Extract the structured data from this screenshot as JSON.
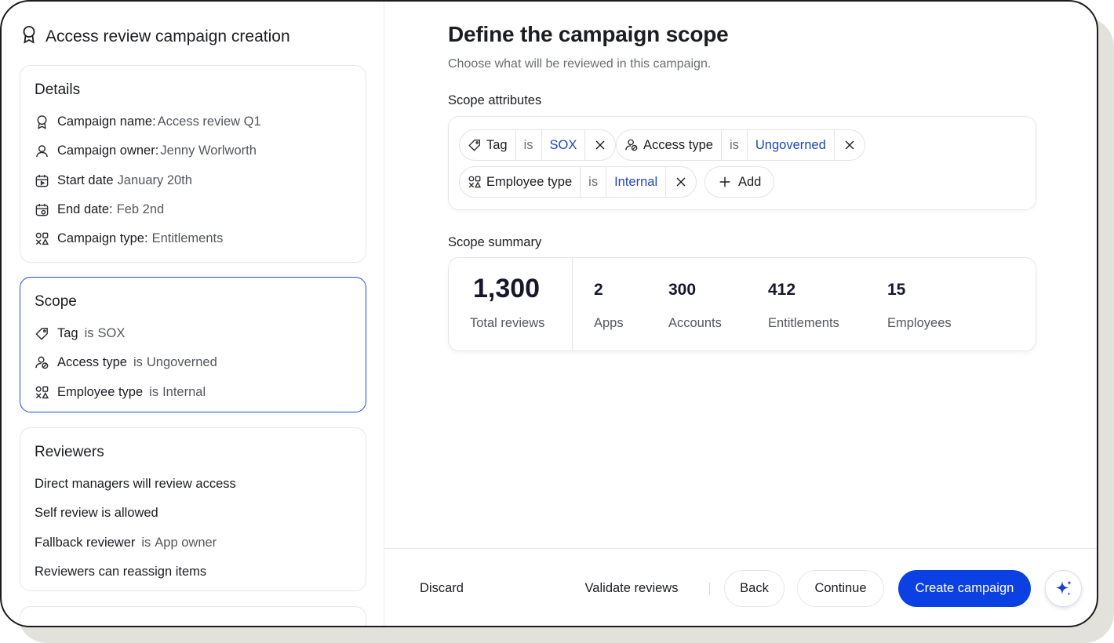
{
  "app": {
    "title": "Access review campaign creation"
  },
  "details": {
    "title": "Details",
    "rows": [
      {
        "label": "Campaign name:",
        "value": "Access review Q1",
        "icon": "badge-icon"
      },
      {
        "label": "Campaign owner:",
        "value": "Jenny Worlworth",
        "icon": "user-icon"
      },
      {
        "label": "Start date",
        "value": "January 20th",
        "icon": "calendar-start-icon"
      },
      {
        "label": "End date:",
        "value": "Feb 2nd",
        "icon": "calendar-end-icon"
      },
      {
        "label": "Campaign type:",
        "value": "Entitlements",
        "icon": "shapes-icon"
      }
    ]
  },
  "scope": {
    "title": "Scope",
    "rows": [
      {
        "label": "Tag",
        "op": "is",
        "value": "SOX",
        "icon": "tag-icon"
      },
      {
        "label": "Access type",
        "op": "is",
        "value": "Ungoverned",
        "icon": "access-type-icon"
      },
      {
        "label": "Employee type",
        "op": "is",
        "value": "Internal",
        "icon": "shapes-icon"
      }
    ]
  },
  "reviewers": {
    "title": "Reviewers",
    "rows": [
      {
        "text": "Direct managers will review access"
      },
      {
        "text": "Self review is allowed"
      },
      {
        "label": "Fallback reviewer",
        "op": "is",
        "value": "App owner"
      },
      {
        "text": "Reviewers can reassign items"
      }
    ]
  },
  "main": {
    "title": "Define the campaign scope",
    "subtitle": "Choose what will be reviewed in this campaign.",
    "attributes_label": "Scope attributes",
    "filters": [
      {
        "key": "Tag",
        "op": "is",
        "value": "SOX"
      },
      {
        "key": "Access type",
        "op": "is",
        "value": "Ungoverned"
      },
      {
        "key": "Employee type",
        "op": "is",
        "value": "Internal"
      }
    ],
    "add_label": "Add",
    "summary_label": "Scope summary",
    "summary": {
      "total": {
        "value": "1,300",
        "label": "Total reviews"
      },
      "stats": [
        {
          "value": "2",
          "label": "Apps"
        },
        {
          "value": "300",
          "label": "Accounts"
        },
        {
          "value": "412",
          "label": "Entitlements"
        },
        {
          "value": "15",
          "label": "Employees"
        }
      ]
    }
  },
  "footer": {
    "discard": "Discard",
    "validate": "Validate reviews",
    "back": "Back",
    "continue": "Continue",
    "create": "Create campaign"
  },
  "colors": {
    "primary": "#0b40e2",
    "active_border": "#1f4fd1",
    "value_link": "#1f47b8"
  }
}
